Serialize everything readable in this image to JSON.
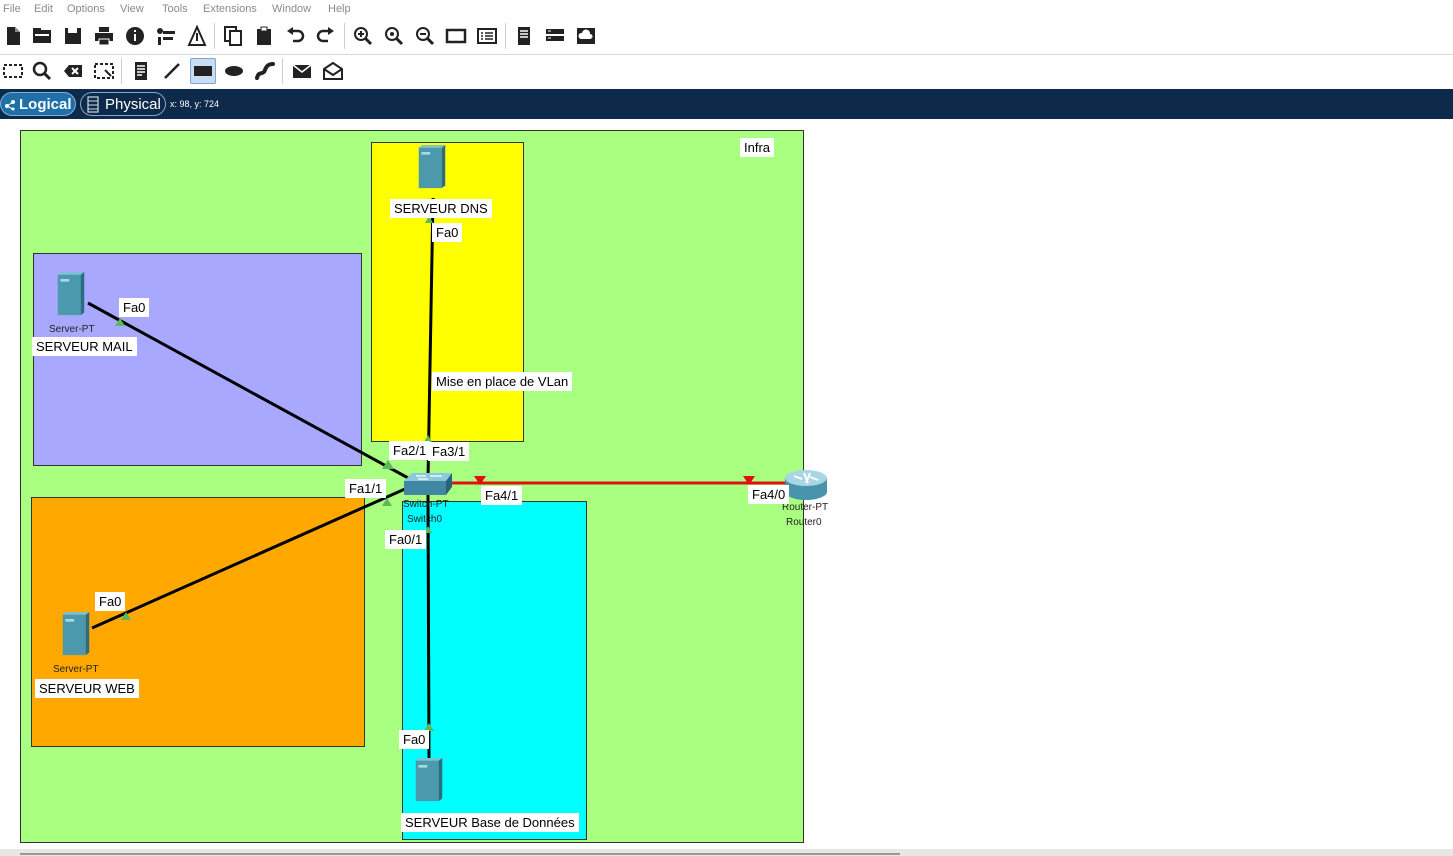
{
  "menu": [
    "File",
    "Edit",
    "Options",
    "View",
    "Tools",
    "Extensions",
    "Window",
    "Help"
  ],
  "toolbar1_icons": [
    "new-file-icon",
    "open-folder-icon",
    "save-icon",
    "print-icon",
    "info-icon",
    "activity-wizard-icon",
    "custom-device-icon",
    "copy-icon",
    "paste-icon",
    "undo-icon",
    "redo-icon",
    "zoom-in-icon",
    "zoom-reset-icon",
    "zoom-out-icon",
    "drawing-palette-icon",
    "custom-devices-dialog-icon",
    "viewport-icon",
    "network-info-icon",
    "cloud-icon"
  ],
  "toolbar2_icons": [
    "select-icon",
    "inspect-icon",
    "delete-icon",
    "resize-icon",
    "place-note-icon",
    "draw-line-icon",
    "draw-rectangle-icon",
    "draw-ellipse-icon",
    "freeform-icon",
    "add-simple-pdu-icon",
    "add-complex-pdu-icon"
  ],
  "tabs": {
    "logical": "Logical",
    "physical": "Physical"
  },
  "coords": "x: 98, y: 724",
  "colors": {
    "infra": "#a8ff80",
    "dns_area": "#ffff00",
    "mail_area": "#a8a8ff",
    "web_area": "#ffa800",
    "db_area": "#00ffff",
    "link": "#000000",
    "router_link": "#e01010",
    "port_up": "#5cb85c",
    "port_down": "#e01010"
  },
  "areas": {
    "infra": "Infra",
    "vlan_note": "Mise en place de VLan"
  },
  "devices": {
    "dns": {
      "name": "SERVEUR DNS",
      "port": "Fa0"
    },
    "mail": {
      "type": "Server-PT",
      "name": "SERVEUR MAIL",
      "port": "Fa0"
    },
    "web": {
      "type": "Server-PT",
      "name": "SERVEUR WEB",
      "port": "Fa0"
    },
    "db": {
      "name": "SERVEUR Base de Données",
      "port": "Fa0"
    },
    "switch": {
      "type": "Switch-PT",
      "name": "Switch0",
      "ports": {
        "fa2_1": "Fa2/1",
        "fa3_1": "Fa3/1",
        "fa1_1": "Fa1/1",
        "fa0_1": "Fa0/1",
        "fa4_1": "Fa4/1"
      }
    },
    "router": {
      "type": "Router-PT",
      "name": "Router0",
      "port": "Fa4/0"
    }
  }
}
